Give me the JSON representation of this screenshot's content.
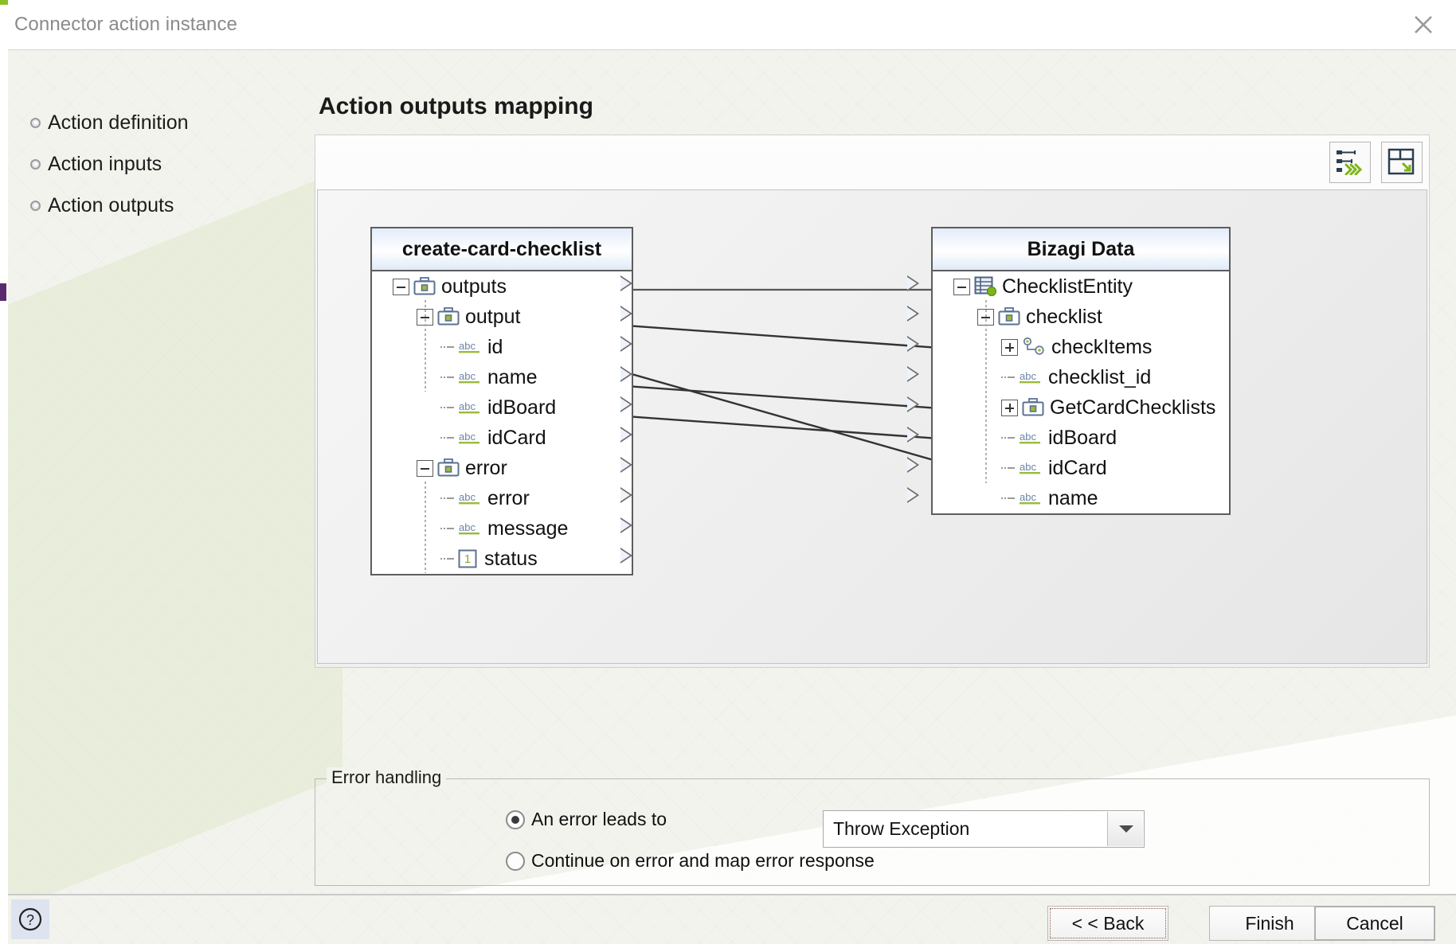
{
  "window": {
    "title": "Connector action instance",
    "close_icon": "close-icon"
  },
  "sidebar": {
    "items": [
      {
        "label": "Action definition"
      },
      {
        "label": "Action inputs"
      },
      {
        "label": "Action outputs"
      }
    ]
  },
  "main": {
    "page_title": "Action outputs mapping",
    "toolbar": [
      {
        "name": "auto-map-icon",
        "tooltip": "Auto map"
      },
      {
        "name": "layout-icon",
        "tooltip": "Arrange"
      }
    ]
  },
  "source_panel": {
    "title": "create-card-checklist",
    "nodes": [
      {
        "label": "outputs",
        "depth": 0,
        "icon": "briefcase-icon",
        "toggle": "minus"
      },
      {
        "label": "output",
        "depth": 1,
        "icon": "briefcase-icon",
        "toggle": "minus"
      },
      {
        "label": "id",
        "depth": 2,
        "icon": "abc-icon",
        "toggle": "none"
      },
      {
        "label": "name",
        "depth": 2,
        "icon": "abc-icon",
        "toggle": "none"
      },
      {
        "label": "idBoard",
        "depth": 2,
        "icon": "abc-icon",
        "toggle": "none"
      },
      {
        "label": "idCard",
        "depth": 2,
        "icon": "abc-icon",
        "toggle": "none"
      },
      {
        "label": "error",
        "depth": 1,
        "icon": "briefcase-icon",
        "toggle": "minus"
      },
      {
        "label": "error",
        "depth": 2,
        "icon": "abc-icon",
        "toggle": "none"
      },
      {
        "label": "message",
        "depth": 2,
        "icon": "abc-icon",
        "toggle": "none"
      },
      {
        "label": "status",
        "depth": 2,
        "icon": "number-icon",
        "toggle": "none"
      }
    ]
  },
  "target_panel": {
    "title": "Bizagi Data",
    "nodes": [
      {
        "label": "ChecklistEntity",
        "depth": 0,
        "icon": "entity-icon",
        "toggle": "minus"
      },
      {
        "label": "checklist",
        "depth": 1,
        "icon": "briefcase-icon",
        "toggle": "minus"
      },
      {
        "label": "checkItems",
        "depth": 2,
        "icon": "collection-icon",
        "toggle": "plus"
      },
      {
        "label": "checklist_id",
        "depth": 2,
        "icon": "abc-icon",
        "toggle": "none"
      },
      {
        "label": "GetCardChecklists",
        "depth": 2,
        "icon": "briefcase-icon",
        "toggle": "plus"
      },
      {
        "label": "idBoard",
        "depth": 2,
        "icon": "abc-icon",
        "toggle": "none"
      },
      {
        "label": "idCard",
        "depth": 2,
        "icon": "abc-icon",
        "toggle": "none"
      },
      {
        "label": "name",
        "depth": 2,
        "icon": "abc-icon",
        "toggle": "none"
      }
    ]
  },
  "mappings": [
    {
      "from": "output",
      "to": "checklist",
      "from_index": 1,
      "to_index": 1
    },
    {
      "from": "id",
      "to": "checklist_id",
      "from_index": 2,
      "to_index": 3
    },
    {
      "from": "name",
      "to": "name",
      "from_index": 3,
      "to_index": 7
    },
    {
      "from": "idBoard",
      "to": "idBoard",
      "from_index": 4,
      "to_index": 5
    },
    {
      "from": "idCard",
      "to": "idCard",
      "from_index": 5,
      "to_index": 6
    }
  ],
  "error_handling": {
    "legend": "Error handling",
    "options": [
      {
        "label": "An error leads to",
        "selected": true
      },
      {
        "label": "Continue on error and map error response",
        "selected": false
      }
    ],
    "select_value": "Throw Exception"
  },
  "footer": {
    "help_icon": "help-icon",
    "back_label": "< < Back",
    "finish_label": "Finish",
    "cancel_label": "Cancel"
  }
}
